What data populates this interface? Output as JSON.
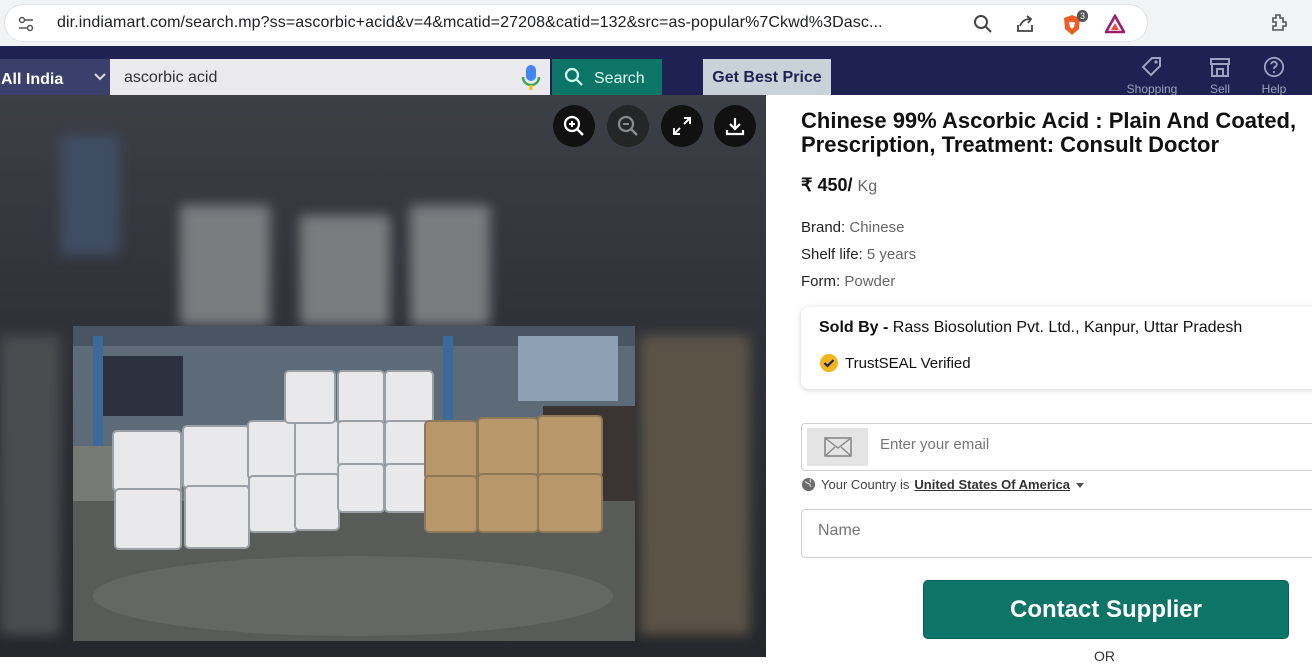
{
  "browser": {
    "url": "dir.indiamart.com/search.mp?ss=ascorbic+acid&v=4&mcatid=27208&catid=132&src=as-popular%7Ckwd%3Dasc...",
    "brave_badge": "3"
  },
  "header": {
    "location": "All India",
    "search_value": "ascorbic acid",
    "search_button": "Search",
    "get_best_price": "Get Best Price",
    "nav": [
      "Shopping",
      "Sell",
      "Help"
    ]
  },
  "product": {
    "title": "Chinese 99% Ascorbic Acid : Plain And Coated, Prescription, Treatment: Consult Doctor",
    "price": "₹ 450/",
    "price_unit": "Kg",
    "specs": [
      {
        "label": "Brand:",
        "value": "Chinese"
      },
      {
        "label": "Shelf life:",
        "value": "5 years"
      },
      {
        "label": "Form:",
        "value": "Powder"
      }
    ]
  },
  "seller": {
    "sold_by_label": "Sold By -",
    "name": "Rass Biosolution Pvt. Ltd., Kanpur, Uttar Pradesh",
    "trust": "TrustSEAL Verified"
  },
  "form": {
    "email_placeholder": "Enter your email",
    "country_label": "Your Country is",
    "country_value": "United States Of America",
    "name_placeholder": "Name",
    "contact_button": "Contact Supplier",
    "or": "OR"
  },
  "colors": {
    "header_bg": "#1f2153",
    "accent_green": "#0c7567"
  }
}
